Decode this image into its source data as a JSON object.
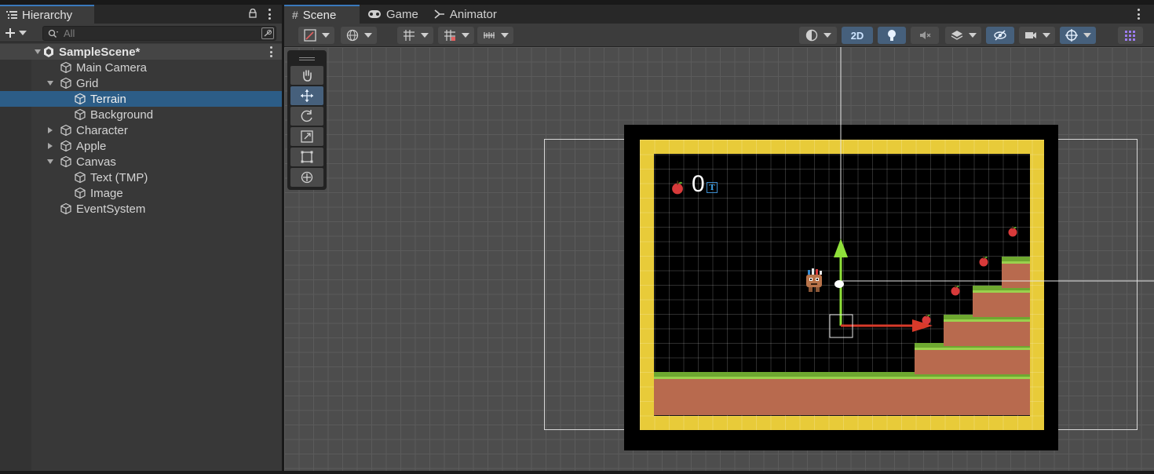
{
  "hierarchy": {
    "tab_label": "Hierarchy",
    "search_placeholder": "All",
    "scene_name": "SampleScene*",
    "items": [
      {
        "label": "Main Camera"
      },
      {
        "label": "Grid"
      },
      {
        "label": "Terrain"
      },
      {
        "label": "Background"
      },
      {
        "label": "Character"
      },
      {
        "label": "Apple"
      },
      {
        "label": "Canvas"
      },
      {
        "label": "Text (TMP)"
      },
      {
        "label": "Image"
      },
      {
        "label": "EventSystem"
      }
    ]
  },
  "scene": {
    "tabs": [
      {
        "label": "Scene"
      },
      {
        "label": "Game"
      },
      {
        "label": "Animator"
      }
    ],
    "toolbar": {
      "mode_2d": "2D"
    },
    "game_ui": {
      "score": "0",
      "tmp_glyph": "T"
    }
  },
  "colors": {
    "accent": "#3a79bb",
    "selection": "#2c5d87",
    "border_yellow": "#e8cb39",
    "grass": "#6ea830",
    "dirt": "#b86a4e"
  },
  "icons": {
    "tools": [
      "hand-icon",
      "move-icon",
      "rotate-icon",
      "scale-icon",
      "rect-icon",
      "transform-icon"
    ]
  }
}
